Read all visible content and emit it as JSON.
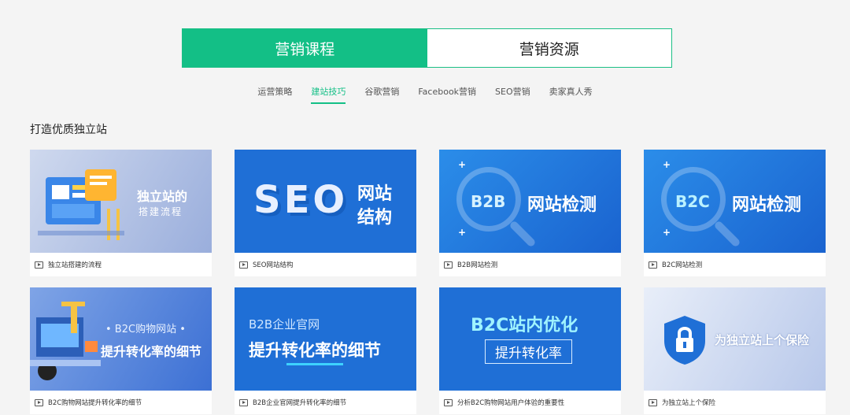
{
  "tabs": [
    {
      "label": "营销课程"
    },
    {
      "label": "营销资源"
    }
  ],
  "subnav": [
    "运营策略",
    "建站技巧",
    "谷歌营销",
    "Facebook营销",
    "SEO营销",
    "卖家真人秀"
  ],
  "section_title": "打造优质独立站",
  "cards": [
    {
      "caption": "独立站搭建的流程",
      "thumb_line1": "独立站的",
      "thumb_line2": "搭建流程"
    },
    {
      "caption": "SEO网站结构",
      "thumb_big": "SEO",
      "thumb_line1": "网站",
      "thumb_line2": "结构"
    },
    {
      "caption": "B2B网站检测",
      "thumb_badge": "B2B",
      "thumb_line1": "网站检测"
    },
    {
      "caption": "B2C网站检测",
      "thumb_badge": "B2C",
      "thumb_line1": "网站检测"
    },
    {
      "caption": "B2C购物网站提升转化率的细节",
      "thumb_line1": "• B2C购物网站 •",
      "thumb_line2": "提升转化率的细节"
    },
    {
      "caption": "B2B企业官网提升转化率的细节",
      "thumb_line1": "B2B企业官网",
      "thumb_line2": "提升转化率的细节"
    },
    {
      "caption": "分析B2C购物网站用户体验的重要性",
      "thumb_line1": "B2C站内优化",
      "thumb_line2": "提升转化率"
    },
    {
      "caption": "为独立站上个保险",
      "thumb_line1": "为独立站上个保险"
    }
  ],
  "colors": {
    "accent": "#13bf86",
    "card_blue": "#1f6fd6"
  }
}
